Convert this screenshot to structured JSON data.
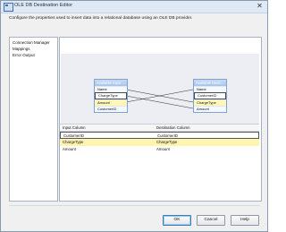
{
  "window": {
    "title": "OLE DB Destination Editor",
    "close_glyph": "✕"
  },
  "description": "Configure the properties used to insert data into a relational database using an OLE DB provider.",
  "nav": {
    "items": [
      "Connection Manager",
      "Mappings",
      "Error Output"
    ]
  },
  "mapping_canvas": {
    "input_table": {
      "title": "Available Input ...",
      "columns": [
        "Name",
        "ChargeType",
        "Amount",
        "CustomerID"
      ]
    },
    "dest_table": {
      "title": "Available Desti...",
      "columns": [
        "Name",
        "CustomerID",
        "ChargeType",
        "Amount"
      ]
    }
  },
  "grid": {
    "headers": [
      "Input Column",
      "Destination Column"
    ],
    "rows": [
      [
        "CustomerID",
        "CustomerID"
      ],
      [
        "ChargeType",
        "ChargeType"
      ],
      [
        "Amount",
        "Amount"
      ]
    ]
  },
  "buttons": {
    "ok": "OK",
    "cancel": "Cancel",
    "help": "Help"
  },
  "colors": {
    "title_bar": "#dfe9f5",
    "selection": "#fff4b0",
    "link": "#7fa3cf"
  }
}
